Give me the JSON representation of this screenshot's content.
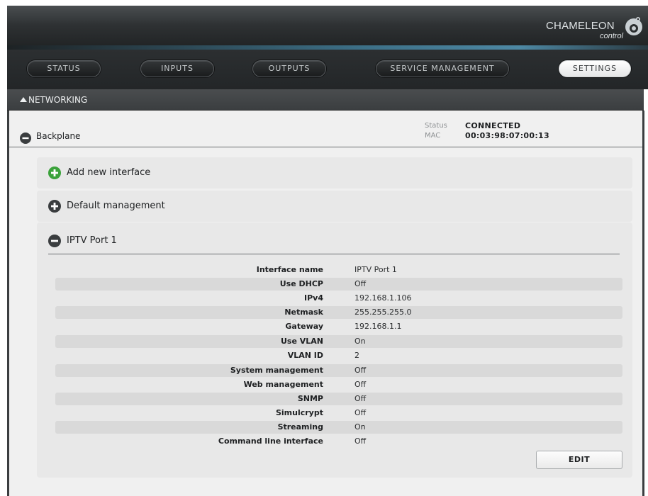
{
  "brand": {
    "name": "CHAMELEON",
    "sub": "control"
  },
  "nav": {
    "tabs": [
      {
        "label": "STATUS"
      },
      {
        "label": "INPUTS"
      },
      {
        "label": "OUTPUTS"
      },
      {
        "label": "SERVICE MANAGEMENT"
      },
      {
        "label": "SETTINGS",
        "active": true
      }
    ]
  },
  "section": {
    "title": "NETWORKING"
  },
  "backplane": {
    "title": "Backplane",
    "status_label": "Status",
    "status_value": "CONNECTED",
    "mac_label": "MAC",
    "mac_value": "00:03:98:07:00:13"
  },
  "interfaces": {
    "add_label": "Add new interface",
    "default_label": "Default management",
    "port_label": "IPTV Port 1"
  },
  "details": {
    "rows": [
      {
        "key": "Interface name",
        "value": "IPTV Port 1"
      },
      {
        "key": "Use DHCP",
        "value": "Off"
      },
      {
        "key": "IPv4",
        "value": "192.168.1.106"
      },
      {
        "key": "Netmask",
        "value": "255.255.255.0"
      },
      {
        "key": "Gateway",
        "value": "192.168.1.1"
      },
      {
        "key": "Use VLAN",
        "value": "On"
      },
      {
        "key": "VLAN ID",
        "value": "2"
      },
      {
        "key": "System management",
        "value": "Off"
      },
      {
        "key": "Web management",
        "value": "Off"
      },
      {
        "key": "SNMP",
        "value": "Off"
      },
      {
        "key": "Simulcrypt",
        "value": "Off"
      },
      {
        "key": "Streaming",
        "value": "On"
      },
      {
        "key": "Command line interface",
        "value": "Off"
      }
    ]
  },
  "actions": {
    "edit_label": "EDIT"
  },
  "colors": {
    "add_icon": "#3aa23a",
    "dark_icon": "#3a3d3f",
    "active_tab": "#ffffff"
  }
}
